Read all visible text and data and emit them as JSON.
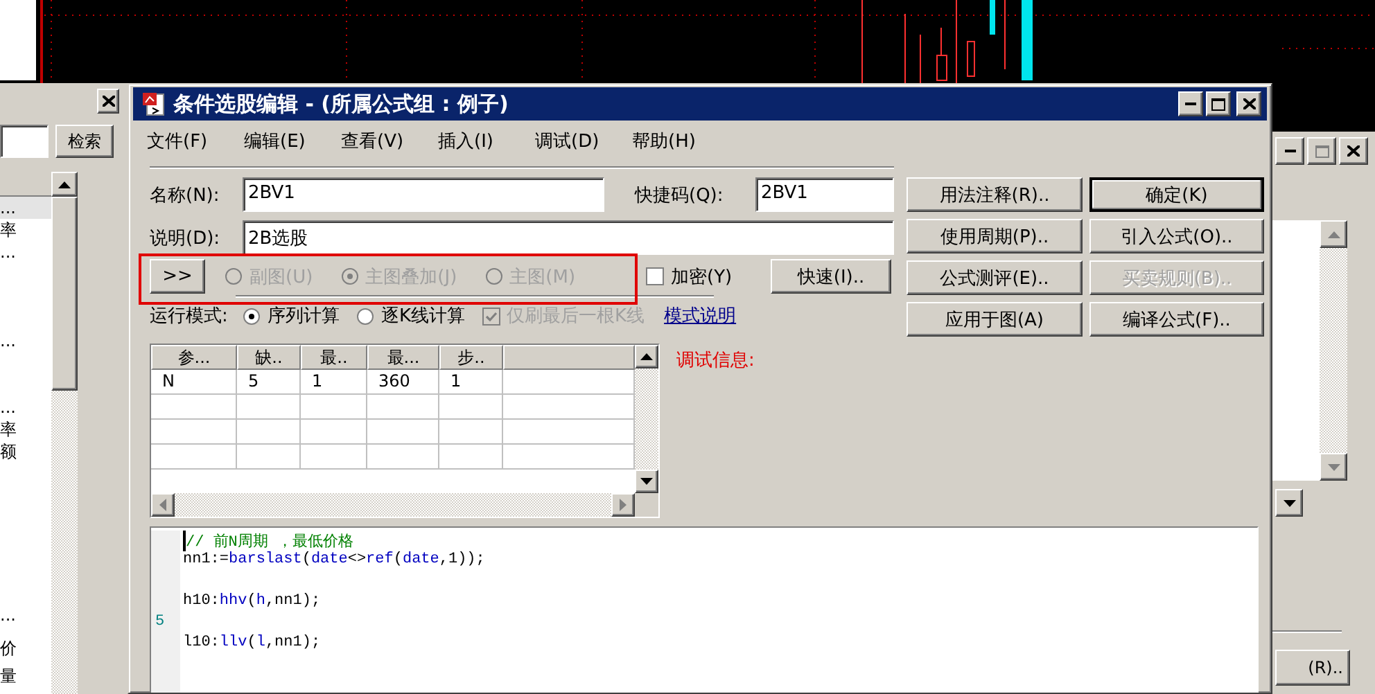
{
  "left_panel": {
    "search_button": "检索",
    "list_items": [
      {
        "text": "...",
        "selected": true
      },
      {
        "text": "率",
        "selected": false
      },
      {
        "text": "...",
        "selected": false
      },
      {
        "text": "...",
        "selected": false
      },
      {
        "text": "...",
        "selected": false
      },
      {
        "text": "率",
        "selected": false
      },
      {
        "text": "额",
        "selected": false
      },
      {
        "text": "...",
        "selected": false
      },
      {
        "text": "价",
        "selected": false
      },
      {
        "text": "量",
        "selected": false
      }
    ]
  },
  "dialog": {
    "title": "条件选股编辑 - (所属公式组 : 例子)",
    "menu": [
      "文件(F)",
      "编辑(E)",
      "查看(V)",
      "插入(I)",
      "调试(D)",
      "帮助(H)"
    ],
    "name_label": "名称(N):",
    "name_value": "2BV1",
    "shortcut_label": "快捷码(Q):",
    "shortcut_value": "2BV1",
    "desc_label": "说明(D):",
    "desc_value": "2B选股",
    "expand_button": ">>",
    "chart_types": [
      {
        "label": "副图(U)",
        "selected": false,
        "disabled": true
      },
      {
        "label": "主图叠加(J)",
        "selected": true,
        "disabled": true
      },
      {
        "label": "主图(M)",
        "selected": false,
        "disabled": true
      }
    ],
    "encrypt": {
      "label": "加密(Y)",
      "checked": false
    },
    "quick_button": "快速(I)..",
    "run_mode": {
      "label": "运行模式:",
      "options": [
        {
          "label": "序列计算",
          "selected": true
        },
        {
          "label": "逐K线计算",
          "selected": false
        }
      ],
      "refresh_last": {
        "label": "仅刷最后一根K线",
        "checked": true,
        "disabled": true
      },
      "help_link": "模式说明"
    },
    "buttons": [
      {
        "label": "用法注释(R)..",
        "disabled": false,
        "default": false
      },
      {
        "label": "确定(K)",
        "disabled": false,
        "default": true
      },
      {
        "label": "使用周期(P)..",
        "disabled": false,
        "default": false
      },
      {
        "label": "引入公式(O)..",
        "disabled": false,
        "default": false
      },
      {
        "label": "公式测评(E)..",
        "disabled": false,
        "default": false
      },
      {
        "label": "买卖规则(B)..",
        "disabled": true,
        "default": false
      },
      {
        "label": "应用于图(A)",
        "disabled": false,
        "default": false
      },
      {
        "label": "编译公式(F)..",
        "disabled": false,
        "default": false
      }
    ],
    "params_table": {
      "columns": [
        "参...",
        "缺..",
        "最..",
        "最...",
        "步.."
      ],
      "rows": [
        [
          "N",
          "5",
          "1",
          "360",
          "1"
        ]
      ]
    },
    "debug_label": "调试信息:",
    "code_lines": [
      {
        "kind": "code",
        "tokens": [
          {
            "kind": "comment",
            "text": "// 前N周期 ，最低价格"
          }
        ]
      },
      {
        "kind": "code",
        "tokens": [
          {
            "kind": "plain",
            "text": "nn1:="
          },
          {
            "kind": "keyword",
            "text": "barslast"
          },
          {
            "kind": "plain",
            "text": "("
          },
          {
            "kind": "keyword",
            "text": "date"
          },
          {
            "kind": "plain",
            "text": "<>"
          },
          {
            "kind": "keyword",
            "text": "ref"
          },
          {
            "kind": "plain",
            "text": "("
          },
          {
            "kind": "keyword",
            "text": "date"
          },
          {
            "kind": "plain",
            "text": ",1));"
          }
        ]
      },
      {
        "kind": "blank"
      },
      {
        "kind": "code",
        "tokens": [
          {
            "kind": "plain",
            "text": "h10:"
          },
          {
            "kind": "keyword",
            "text": "hhv"
          },
          {
            "kind": "plain",
            "text": "("
          },
          {
            "kind": "keyword",
            "text": "h"
          },
          {
            "kind": "plain",
            "text": ",nn1);"
          }
        ]
      },
      {
        "kind": "blank",
        "gutter": "5"
      },
      {
        "kind": "code",
        "tokens": [
          {
            "kind": "plain",
            "text": "l10:"
          },
          {
            "kind": "keyword",
            "text": "llv"
          },
          {
            "kind": "plain",
            "text": "("
          },
          {
            "kind": "keyword",
            "text": "l"
          },
          {
            "kind": "plain",
            "text": ",nn1);"
          }
        ]
      }
    ]
  },
  "back_window": {
    "button": "(R).."
  }
}
